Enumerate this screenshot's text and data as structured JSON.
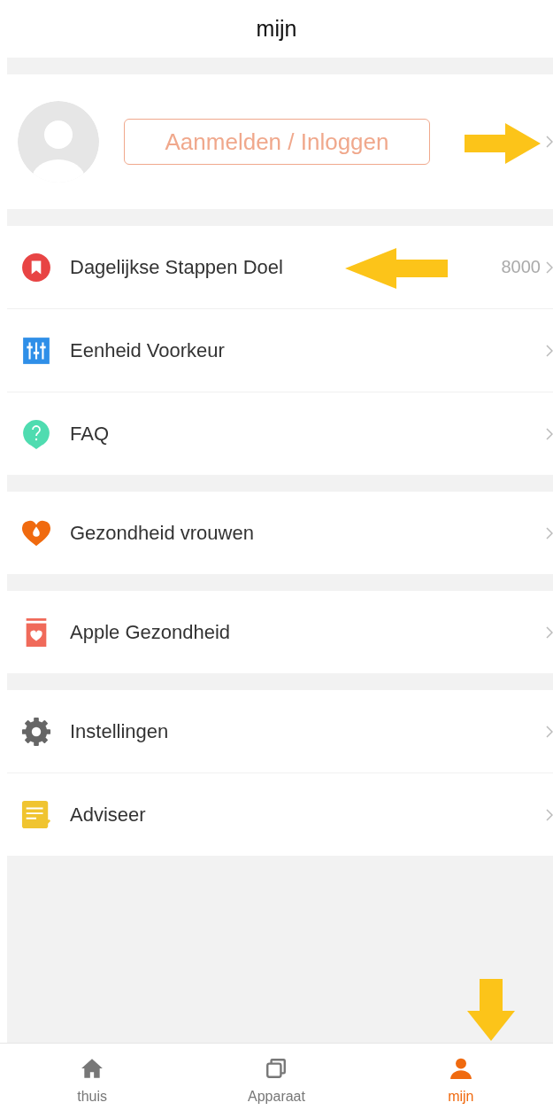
{
  "title": "mijn",
  "profile": {
    "login_button": "Aanmelden / Inloggen"
  },
  "sections": [
    {
      "items": [
        {
          "kind": "goal",
          "label": "Dagelijkse Stappen Doel",
          "value": "8000"
        },
        {
          "kind": "units",
          "label": "Eenheid Voorkeur"
        },
        {
          "kind": "faq",
          "label": "FAQ"
        }
      ]
    },
    {
      "items": [
        {
          "kind": "women",
          "label": "Gezondheid vrouwen"
        }
      ]
    },
    {
      "items": [
        {
          "kind": "apple",
          "label": "Apple Gezondheid"
        }
      ]
    },
    {
      "items": [
        {
          "kind": "settings",
          "label": "Instellingen"
        },
        {
          "kind": "feedback",
          "label": "Adviseer"
        }
      ]
    }
  ],
  "tabs": [
    {
      "kind": "home",
      "label": "thuis",
      "selected": false
    },
    {
      "kind": "device",
      "label": "Apparaat",
      "selected": false
    },
    {
      "kind": "me",
      "label": "mijn",
      "selected": true
    }
  ]
}
